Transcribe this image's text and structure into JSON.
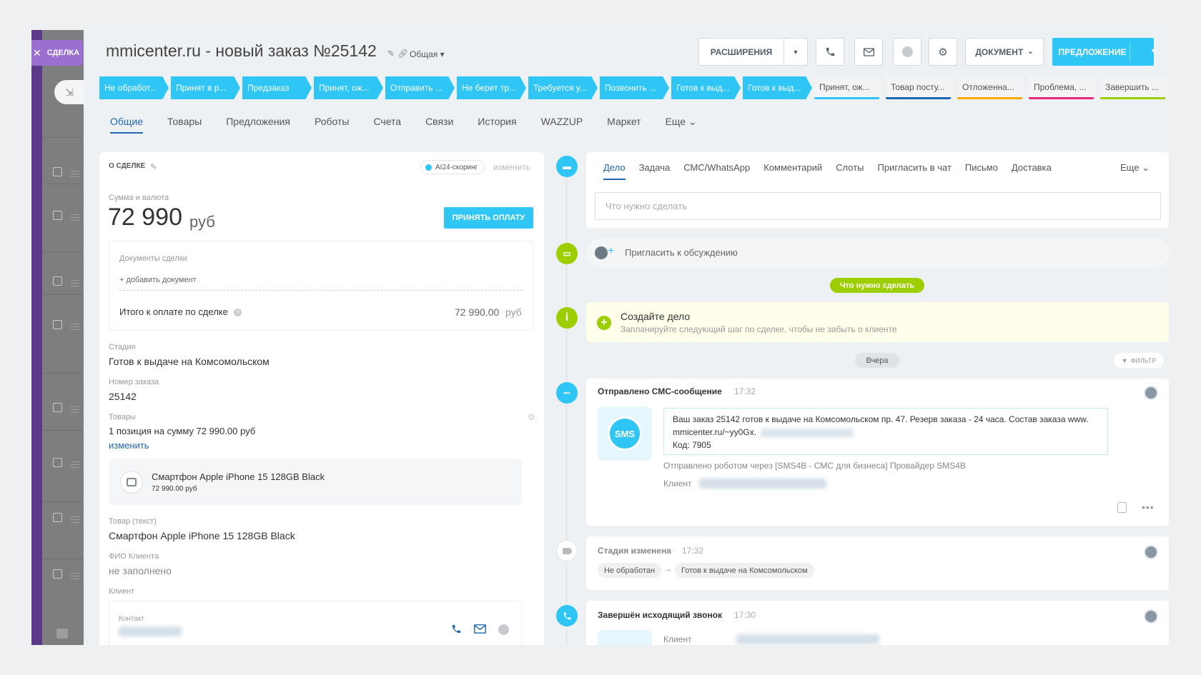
{
  "slider": {
    "close_label": "СДЕЛКА"
  },
  "header": {
    "title": "mmicenter.ru - новый заказ №25142",
    "category": "Общая ▾",
    "extensions_label": "РАСШИРЕНИЯ",
    "document_label": "ДОКУМЕНТ",
    "offer_label": "ПРЕДЛОЖЕНИЕ"
  },
  "stages": [
    {
      "label": "Не обработ...",
      "state": "filled",
      "color": "#2fc6f6"
    },
    {
      "label": "Принят в р...",
      "state": "filled",
      "color": "#2fc6f6"
    },
    {
      "label": "Предзаказ",
      "state": "filled",
      "color": "#2fc6f6"
    },
    {
      "label": "Принят, ож...",
      "state": "filled",
      "color": "#2fc6f6"
    },
    {
      "label": "Отправить ...",
      "state": "filled",
      "color": "#2fc6f6"
    },
    {
      "label": "Не берет тр...",
      "state": "filled",
      "color": "#2fc6f6"
    },
    {
      "label": "Требуется у...",
      "state": "filled",
      "color": "#2fc6f6"
    },
    {
      "label": "Позвонить ...",
      "state": "filled",
      "color": "#2fc6f6"
    },
    {
      "label": "Готов к выд...",
      "state": "filled",
      "color": "#2fc6f6"
    },
    {
      "label": "Готов к выд...",
      "state": "filled",
      "color": "#2fc6f6"
    },
    {
      "label": "Принят, ож...",
      "state": "future",
      "color": "#2fc6f6"
    },
    {
      "label": "Товар посту...",
      "state": "future",
      "color": "#2067b0"
    },
    {
      "label": "Отложенна...",
      "state": "future",
      "color": "#f7a700"
    },
    {
      "label": "Проблема, ...",
      "state": "future",
      "color": "#e6287e"
    },
    {
      "label": "Завершить ...",
      "state": "future",
      "color": "#9dcf00"
    }
  ],
  "tabs": [
    "Общие",
    "Товары",
    "Предложения",
    "Роботы",
    "Счета",
    "Связи",
    "История",
    "WAZZUP",
    "Маркет",
    "Еще ⌄"
  ],
  "about": {
    "heading": "О СДЕЛКЕ",
    "ai_scoring": "AI24-скоринг",
    "change": "изменить",
    "sum_label": "Сумма и валюта",
    "sum_value": "72 990",
    "currency": "руб",
    "pay_button": "ПРИНЯТЬ ОПЛАТУ",
    "docs_label": "Документы сделки",
    "add_doc": "+ добавить документ",
    "total_label": "Итого к оплате по сделке",
    "total_value": "72 990.00",
    "total_currency": "руб",
    "stage_label": "Стадия",
    "stage_value": "Готов к выдаче на Комсомольском",
    "order_label": "Номер заказа",
    "order_value": "25142",
    "goods_label": "Товары",
    "goods_value": "1 позиция на сумму 72 990.00 руб",
    "goods_change": "изменить",
    "product_name": "Смартфон Apple iPhone 15 128GB Black",
    "product_price": "72 990.00 руб",
    "product_text_label": "Товар (текст)",
    "product_text_value": "Смартфон Apple iPhone 15 128GB Black",
    "fio_label": "ФИО Клиента",
    "fio_value": "не заполнено",
    "client_label": "Клиент",
    "contact_label": "Контакт"
  },
  "activity": {
    "tabs": [
      "Дело",
      "Задача",
      "СМС/WhatsApp",
      "Комментарий",
      "Слоты",
      "Пригласить в чат",
      "Письмо",
      "Доставка"
    ],
    "more": "Еще ⌄",
    "input_placeholder": "Что нужно сделать",
    "invite": "Пригласить к обсуждению",
    "todo_pill": "Что нужно сделать",
    "create_title": "Создайте дело",
    "create_subtitle": "Запланируйте следующий шаг по сделке, чтобы не забыть о клиенте",
    "yesterday": "Вчера",
    "filter": "ФИЛЬТР"
  },
  "timeline": {
    "sms_title": "Отправлено СМС-сообщение",
    "sms_time": "17:32",
    "sms_logo": "SMS",
    "sms_line1": "Ваш заказ 25142 готов к выдаче на Комсомольском пр. 47. Резерв заказа - 24 часа. Состав заказа www.",
    "sms_line2": "mmicenter.ru/~yy0Gx.",
    "sms_line3": "Код: 7905",
    "sms_robot": "Отправлено роботом через [SMS4B - СМС для бизнеса] Провайдер SMS4B",
    "sms_client_label": "Клиент",
    "stage_title": "Стадия изменена",
    "stage_time": "17:32",
    "stage_from": "Не обработан",
    "stage_arrow": "→",
    "stage_to": "Готов к выдаче на Комсомольском",
    "call_title": "Завершён исходящий звонок",
    "call_time": "17:30",
    "call_client_label": "Клиент"
  }
}
